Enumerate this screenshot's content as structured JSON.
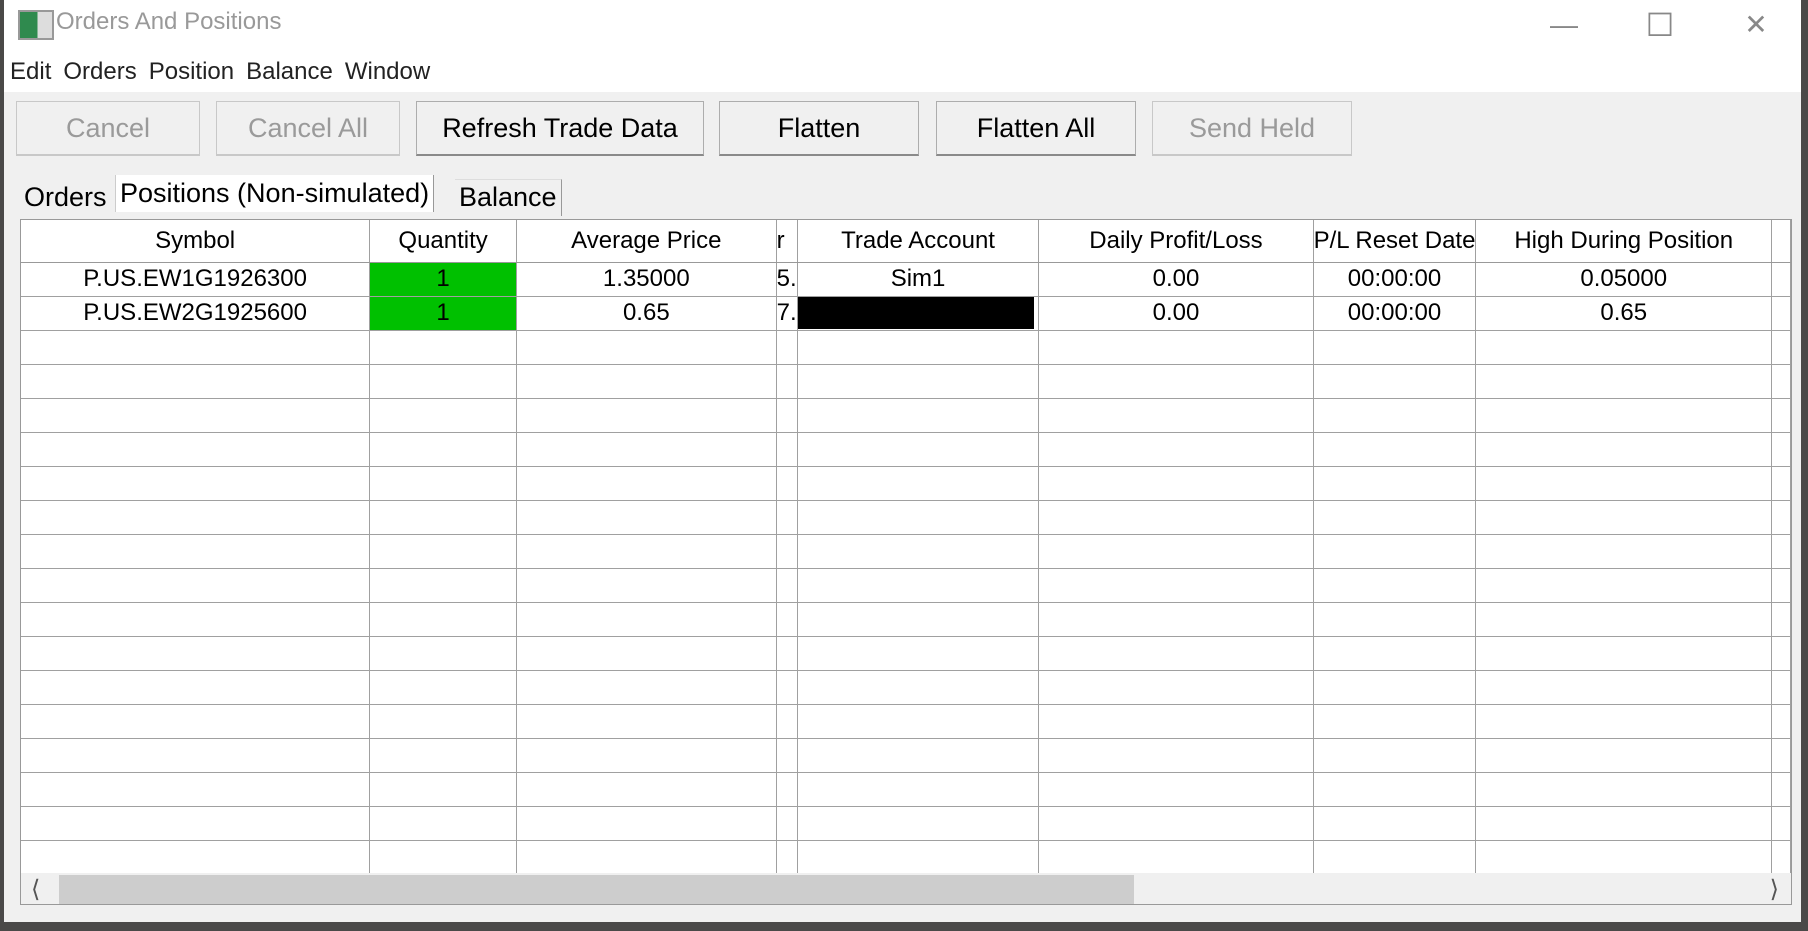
{
  "window": {
    "title": "Orders And Positions",
    "icon": "app-table-icon",
    "controls": [
      "minimize-icon",
      "maximize-icon",
      "close-icon"
    ]
  },
  "menu": [
    "Edit",
    "Orders",
    "Position",
    "Balance",
    "Window"
  ],
  "toolbar": [
    {
      "label": "Cancel",
      "enabled": false
    },
    {
      "label": "Cancel All",
      "enabled": false
    },
    {
      "label": "Refresh Trade Data",
      "enabled": true
    },
    {
      "label": "Flatten",
      "enabled": true
    },
    {
      "label": "Flatten All",
      "enabled": true
    },
    {
      "label": "Send Held",
      "enabled": false
    }
  ],
  "tabs": [
    {
      "label": "Orders"
    },
    {
      "label": "Positions (Non-simulated)",
      "selected": true
    },
    {
      "label": "Balance"
    }
  ],
  "table": {
    "columns": [
      "Symbol",
      "Quantity",
      "Average Price",
      "r",
      "Trade Account",
      "Daily Profit/Loss",
      "P/L Reset Date",
      "High During Position",
      ""
    ],
    "rows": [
      [
        "P.US.EW1G1926300",
        "1",
        "1.35000",
        "5.",
        "Sim1",
        "0.00",
        "00:00:00",
        "0.05000",
        ""
      ],
      [
        "P.US.EW2G1925600",
        "1",
        "0.65",
        "7.",
        "[redacted]",
        "0.00",
        "00:00:00",
        "0.65",
        ""
      ]
    ],
    "quantity_color": "#00c000"
  },
  "scrollbar": {
    "horizontal_position_fraction": 0.0,
    "visible_fraction": 0.62
  }
}
